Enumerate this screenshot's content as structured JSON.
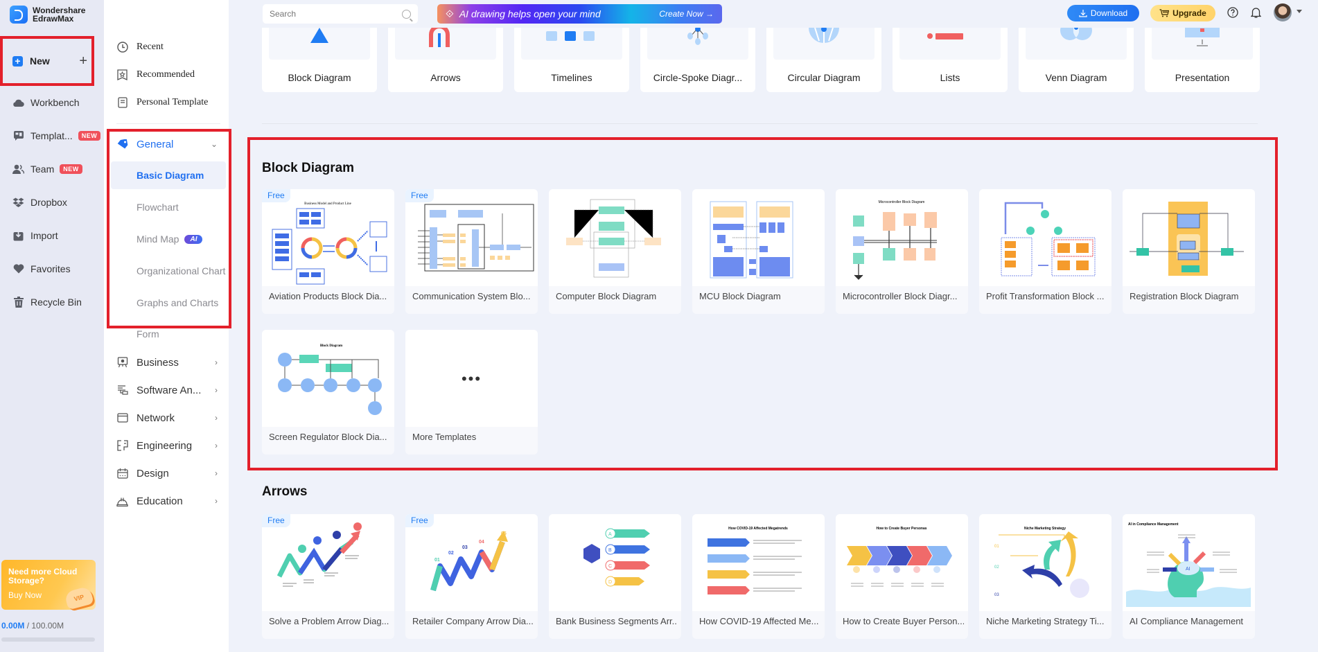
{
  "app": {
    "brand_line1": "Wondershare",
    "brand_line2": "EdrawMax"
  },
  "rail": {
    "new_label": "New",
    "items": [
      {
        "label": "Workbench",
        "icon": "cloud-icon"
      },
      {
        "label": "Templat...",
        "icon": "template-icon",
        "badge": "NEW"
      },
      {
        "label": "Team",
        "icon": "team-icon",
        "badge": "NEW"
      },
      {
        "label": "Dropbox",
        "icon": "dropbox-icon"
      },
      {
        "label": "Import",
        "icon": "import-icon"
      },
      {
        "label": "Favorites",
        "icon": "heart-icon"
      },
      {
        "label": "Recycle Bin",
        "icon": "trash-icon"
      }
    ],
    "promo": {
      "title": "Need more Cloud Storage?",
      "button": "Buy Now",
      "vip": "VIP"
    },
    "storage": {
      "used": "0.00M",
      "separator": " / ",
      "total": "100.00M",
      "used_fraction": 0
    }
  },
  "sidebar": {
    "links": [
      {
        "label": "Recent",
        "icon": "clock-icon"
      },
      {
        "label": "Recommended",
        "icon": "star-bookmark-icon"
      },
      {
        "label": "Personal Template",
        "icon": "document-icon"
      }
    ],
    "general": {
      "label": "General",
      "expanded": true,
      "subitems": [
        {
          "label": "Basic Diagram",
          "active": true
        },
        {
          "label": "Flowchart"
        },
        {
          "label": "Mind Map",
          "badge": "AI"
        },
        {
          "label": "Organizational Chart"
        },
        {
          "label": "Graphs and Charts"
        },
        {
          "label": "Form"
        }
      ]
    },
    "categories": [
      {
        "label": "Business",
        "icon": "presentation-board-icon"
      },
      {
        "label": "Software An...",
        "icon": "software-icon"
      },
      {
        "label": "Network",
        "icon": "window-icon"
      },
      {
        "label": "Engineering",
        "icon": "engineering-icon"
      },
      {
        "label": "Design",
        "icon": "calendar-icon"
      },
      {
        "label": "Education",
        "icon": "hard-hat-icon"
      }
    ]
  },
  "topbar": {
    "search_placeholder": "Search",
    "ai_banner": {
      "text": "AI drawing helps open your mind",
      "cta": "Create Now →"
    },
    "download_label": "Download",
    "upgrade_label": "Upgrade"
  },
  "category_strip": [
    "Block Diagram",
    "Arrows",
    "Timelines",
    "Circle-Spoke Diagr...",
    "Circular Diagram",
    "Lists",
    "Venn Diagram",
    "Presentation"
  ],
  "sections": {
    "block": {
      "title": "Block Diagram",
      "templates": [
        {
          "name": "Aviation Products Block Dia...",
          "free": "Free"
        },
        {
          "name": "Communication System Blo...",
          "free": "Free"
        },
        {
          "name": "Computer Block Diagram"
        },
        {
          "name": "MCU Block Diagram"
        },
        {
          "name": "Microcontroller Block Diagr..."
        },
        {
          "name": "Profit Transformation Block ..."
        },
        {
          "name": "Registration Block Diagram"
        },
        {
          "name": "Screen Regulator Block Dia..."
        },
        {
          "name": "More Templates",
          "more": true
        }
      ]
    },
    "arrows": {
      "title": "Arrows",
      "templates": [
        {
          "name": "Solve a Problem Arrow Diag...",
          "free": "Free"
        },
        {
          "name": "Retailer Company Arrow Dia...",
          "free": "Free"
        },
        {
          "name": "Bank Business Segments Arr..."
        },
        {
          "name": "How COVID-19 Affected Me..."
        },
        {
          "name": "How to Create Buyer Person..."
        },
        {
          "name": "Niche Marketing Strategy Ti..."
        },
        {
          "name": "AI Compliance Management"
        }
      ]
    }
  },
  "colors": {
    "accent": "#1f6ff0",
    "highlight_frame": "#e3202b",
    "badge_new": "#f0505a"
  }
}
